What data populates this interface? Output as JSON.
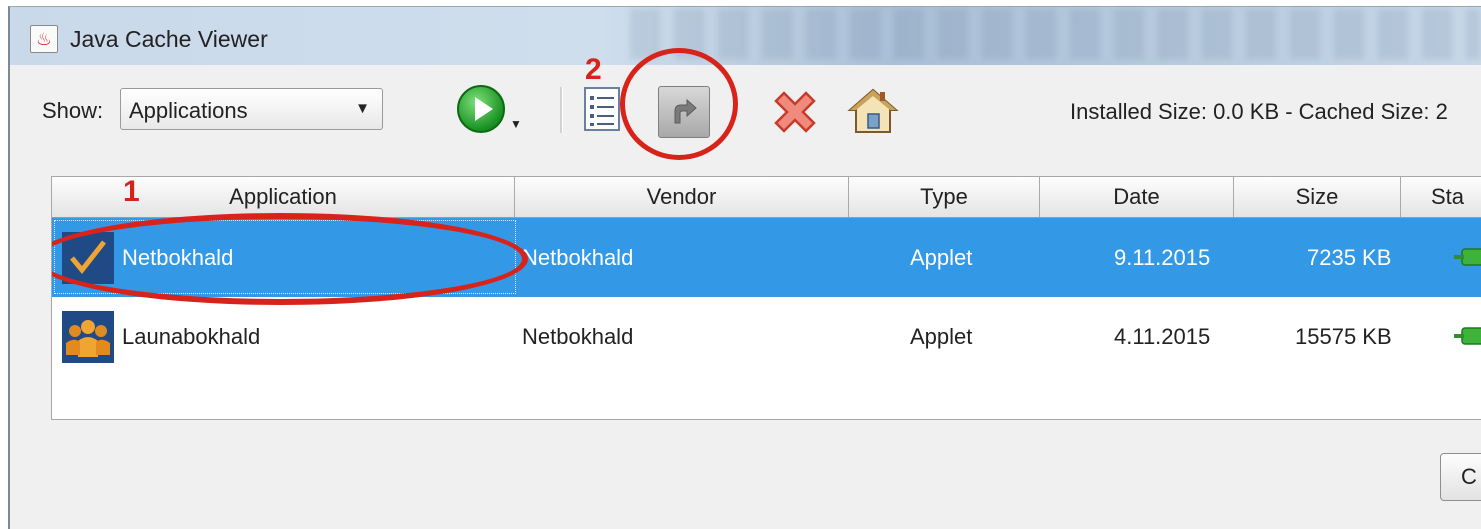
{
  "window": {
    "title": "Java Cache Viewer",
    "app_icon": "java-cup-icon"
  },
  "toolbar": {
    "show_label": "Show:",
    "show_selected": "Applications",
    "run_icon": "play-icon",
    "list_icon": "details-list-icon",
    "shortcut_icon": "install-shortcut-icon",
    "delete_icon": "delete-x-icon",
    "home_icon": "home-icon",
    "size_info": "Installed Size:  0.0 KB - Cached Size:  2"
  },
  "annotations": {
    "label_1": "1",
    "label_2": "2",
    "color": "#d8231b"
  },
  "table": {
    "columns": [
      "Application",
      "Vendor",
      "Type",
      "Date",
      "Size",
      "Sta"
    ],
    "rows": [
      {
        "icon": "netbokhald-check-icon",
        "application": "Netbokhald",
        "vendor": "Netbokhald",
        "type": "Applet",
        "date": "9.11.2015",
        "size": "7235 KB",
        "status_icon": "green-plug-icon",
        "selected": true
      },
      {
        "icon": "launabokhald-people-icon",
        "application": "Launabokhald",
        "vendor": "Netbokhald",
        "type": "Applet",
        "date": "4.11.2015",
        "size": "15575 KB",
        "status_icon": "green-plug-icon",
        "selected": false
      }
    ]
  },
  "footer": {
    "close_label": "C"
  },
  "colors": {
    "selection": "#3399e6",
    "annotation_red": "#d8231b"
  }
}
